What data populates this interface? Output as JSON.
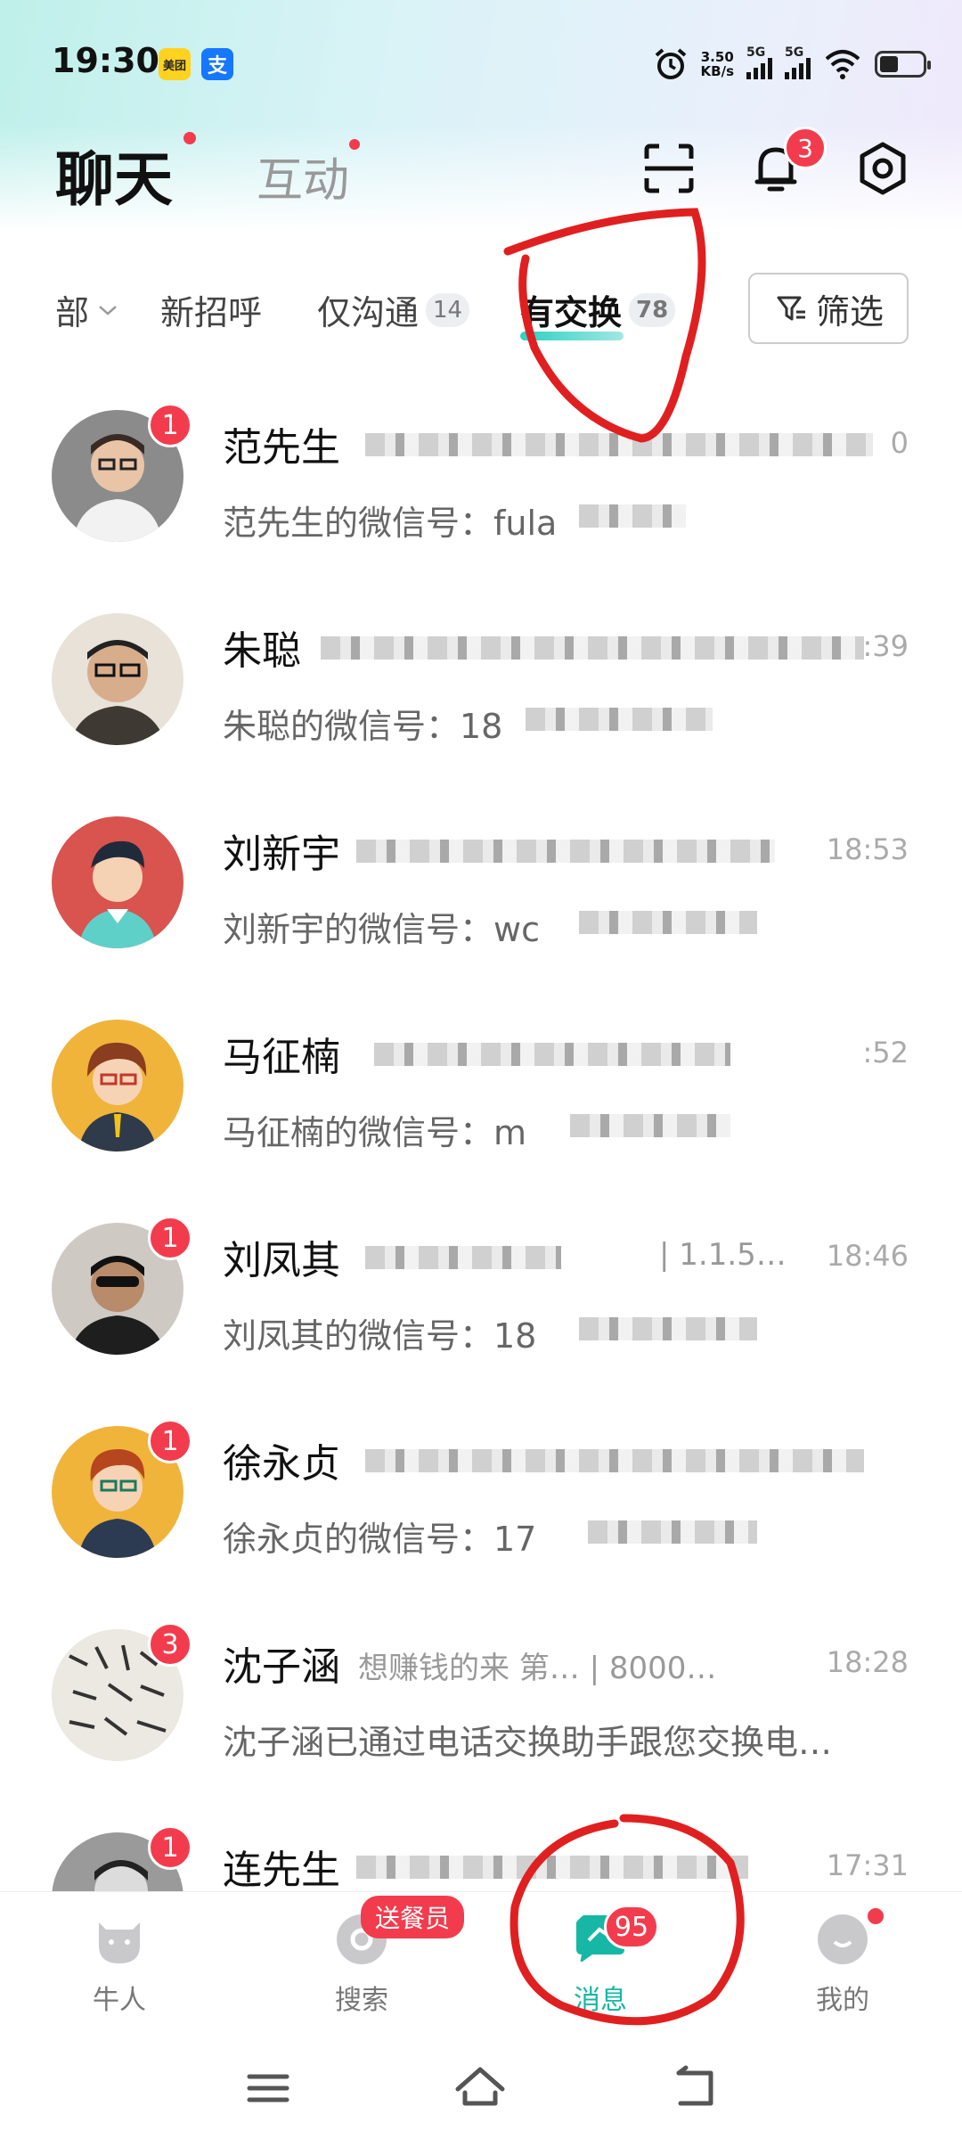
{
  "status_bar": {
    "time": "19:30",
    "apps": [
      "美团",
      "支"
    ],
    "net_speed_value": "3.50",
    "net_speed_unit": "KB/s",
    "sim1": "5G",
    "sim2": "5G"
  },
  "header": {
    "title": "聊天",
    "tab_interact": "互动",
    "notification_count": "3"
  },
  "filters": {
    "items": [
      {
        "label": "部",
        "count": ""
      },
      {
        "label": "新招呼",
        "count": ""
      },
      {
        "label": "仅沟通",
        "count": "14"
      },
      {
        "label": "有交换",
        "count": "78"
      }
    ],
    "active": "有交换",
    "filter_button": "筛选"
  },
  "chats": [
    {
      "name": "范先生",
      "extra": "",
      "time": "0",
      "message": "范先生的微信号：fula",
      "unread": "1"
    },
    {
      "name": "朱聪",
      "extra": "",
      "time": ":39",
      "message": "朱聪的微信号：18",
      "unread": ""
    },
    {
      "name": "刘新宇",
      "extra": "",
      "time": "18:53",
      "message": "刘新宇的微信号：wc",
      "unread": ""
    },
    {
      "name": "马征楠",
      "extra": "",
      "time": ":52",
      "message": "马征楠的微信号：m",
      "unread": ""
    },
    {
      "name": "刘凤其",
      "extra": "| 1.1.5…",
      "time": "18:46",
      "message": "刘凤其的微信号：18",
      "unread": "1"
    },
    {
      "name": "徐永贞",
      "extra": "",
      "time": "",
      "message": "徐永贞的微信号：17",
      "unread": "1"
    },
    {
      "name": "沈子涵",
      "extra": "想赚钱的来 第…   | 8000…",
      "time": "18:28",
      "message": "沈子涵已通过电话交换助手跟您交换电…",
      "unread": "3"
    },
    {
      "name": "连先生",
      "extra": "",
      "time": "17:31",
      "message": "",
      "unread": "1"
    }
  ],
  "bottom_nav": {
    "items": [
      {
        "label": "牛人"
      },
      {
        "label": "搜索"
      },
      {
        "label": "消息"
      },
      {
        "label": "我的"
      }
    ],
    "promo_badge": "送餐员",
    "message_badge": "95",
    "active": "消息"
  },
  "colors": {
    "accent": "#16b7a5",
    "badge": "#f23c4d",
    "annotation": "#e02020"
  }
}
